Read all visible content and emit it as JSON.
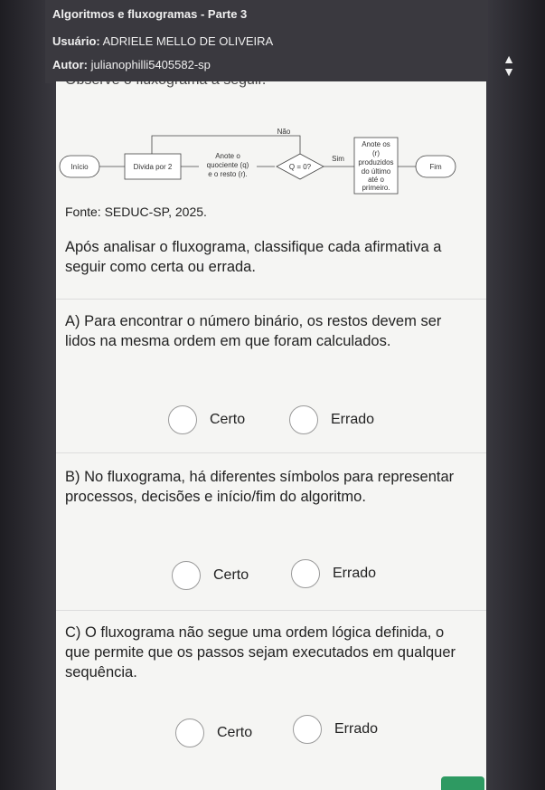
{
  "header": {
    "title": "Algoritmos e fluxogramas - Parte 3",
    "user_label": "Usuário:",
    "user_name": "ADRIELE MELLO DE OLIVEIRA",
    "author_label": "Autor:",
    "author_name": "julianophilli5405582-sp"
  },
  "partial_text": "Observe o fluxograma a seguir.",
  "flowchart": {
    "start": "Início",
    "divide": "Divida por 2",
    "note_lines": [
      "Anote o",
      "quociente (q)",
      "e o resto (r)."
    ],
    "decision": "Q = 0?",
    "no_label": "Não",
    "yes_label": "Sim",
    "write_lines": [
      "Anote os",
      "(r)",
      "produzidos",
      "do último",
      "até o",
      "primeiro."
    ],
    "end": "Fim"
  },
  "source": "Fonte: SEDUC-SP, 2025.",
  "intro": "Após analisar o fluxograma, classifique cada afirmativa a seguir como certa ou errada.",
  "questions": [
    {
      "text": "A) Para encontrar o número binário, os restos devem ser lidos na mesma ordem em que foram calculados.",
      "opt_true": "Certo",
      "opt_false": "Errado"
    },
    {
      "text": "B) No fluxograma, há diferentes símbolos para representar processos, decisões e início/fim do algoritmo.",
      "opt_true": "Certo",
      "opt_false": "Errado"
    },
    {
      "text": "C) O fluxograma não segue uma ordem lógica definida, o que permite que os passos sejam executados em qualquer sequência.",
      "opt_true": "Certo",
      "opt_false": "Errado"
    }
  ],
  "colors": {
    "accent": "#2e9a62",
    "header_bg": "#3a393f"
  }
}
